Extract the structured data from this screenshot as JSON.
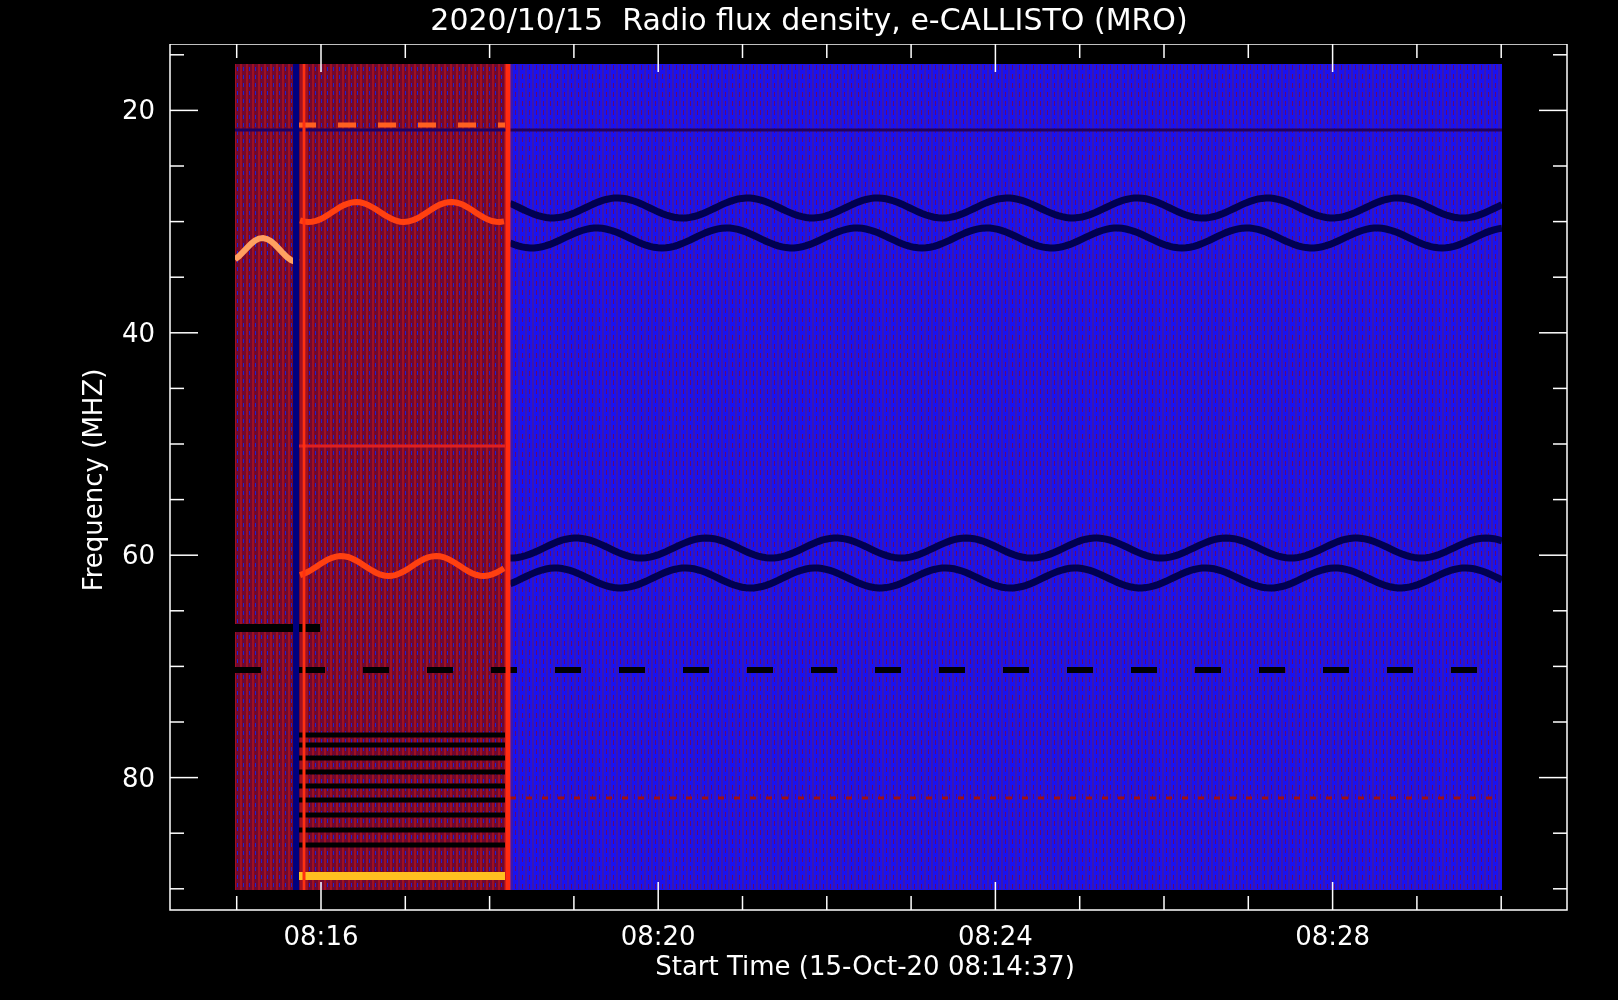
{
  "title": "2020/10/15  Radio flux density, e-CALLISTO (MRO)",
  "plot": {
    "ylabel": "Frequency (MHZ)",
    "xlabel": "Start Time (15-Oct-20 08:14:37)",
    "yticks": [
      "20",
      "40",
      "60",
      "80"
    ],
    "xticks": [
      "08:16",
      "08:20",
      "08:24",
      "08:28"
    ]
  }
}
